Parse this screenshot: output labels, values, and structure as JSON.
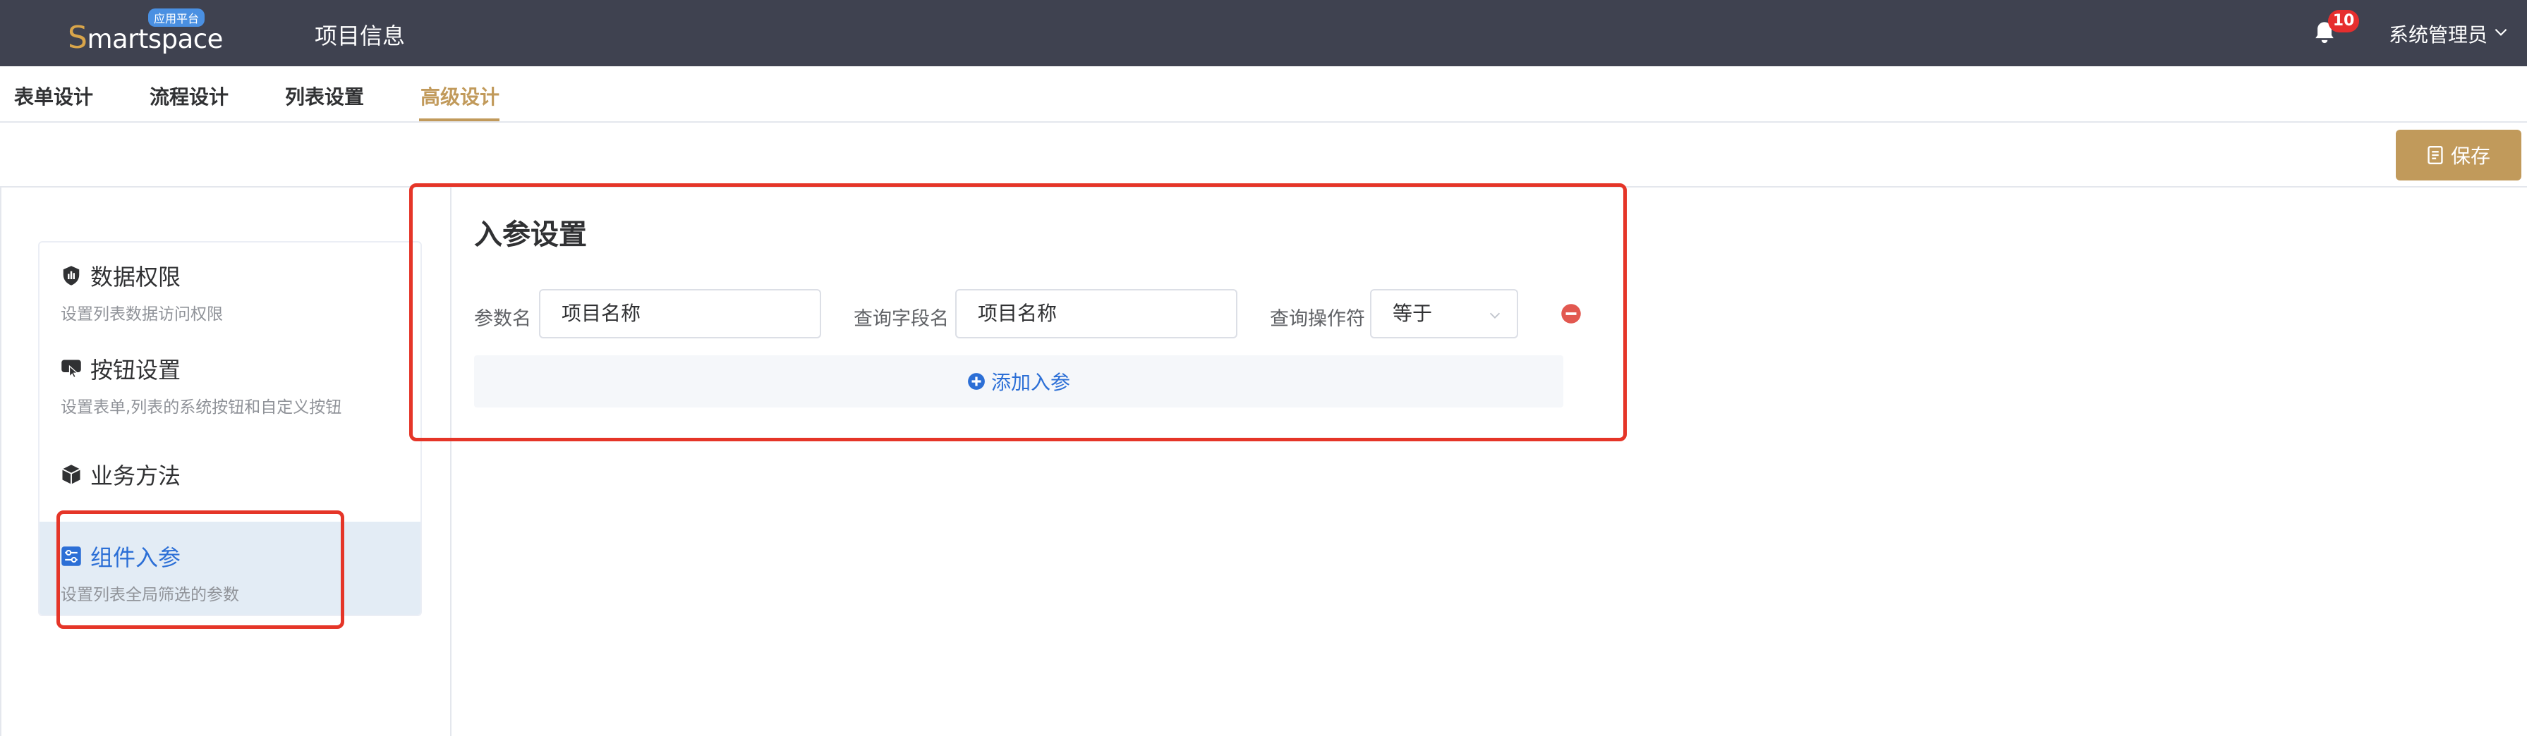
{
  "header": {
    "logo_text_first": "S",
    "logo_text_rest": "martspace",
    "logo_badge": "应用平台",
    "app_title": "项目信息",
    "notification_count": "10",
    "user_name": "系统管理员"
  },
  "tabs": [
    {
      "label": "表单设计"
    },
    {
      "label": "流程设计"
    },
    {
      "label": "列表设置"
    },
    {
      "label": "高级设计"
    }
  ],
  "toolbar": {
    "save_label": "保存"
  },
  "sidebar": {
    "items": [
      {
        "title": "数据权限",
        "desc": "设置列表数据访问权限",
        "icon": "shield-chart-icon"
      },
      {
        "title": "按钮设置",
        "desc": "设置表单,列表的系统按钮和自定义按钮",
        "icon": "click-icon"
      },
      {
        "title": "业务方法",
        "desc": "",
        "icon": "cube-icon"
      },
      {
        "title": "组件入参",
        "desc": "设置列表全局筛选的参数",
        "icon": "sliders-icon"
      }
    ],
    "active_index": 3
  },
  "panel": {
    "title": "入参设置",
    "param": {
      "name_label": "参数名",
      "name_value": "项目名称",
      "field_label": "查询字段名",
      "field_value": "项目名称",
      "op_label": "查询操作符",
      "op_value": "等于"
    },
    "add_label": "添加入参"
  },
  "colors": {
    "header_bg": "#3f4250",
    "accent": "#c19a5b",
    "link": "#2c6fd6",
    "danger": "#e25850",
    "annotation": "#e53528"
  }
}
